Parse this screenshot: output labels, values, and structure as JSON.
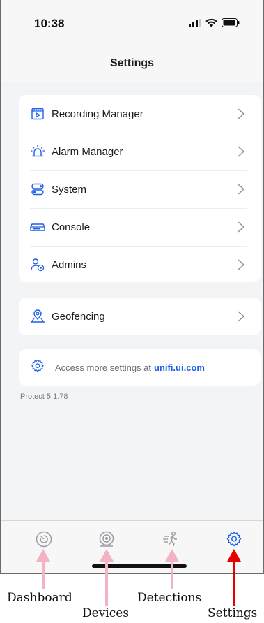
{
  "status_bar": {
    "time": "10:38"
  },
  "header": {
    "title": "Settings"
  },
  "menu": {
    "items": [
      {
        "label": "Recording Manager",
        "icon": "recording-manager-icon"
      },
      {
        "label": "Alarm Manager",
        "icon": "alarm-icon"
      },
      {
        "label": "System",
        "icon": "system-toggle-icon"
      },
      {
        "label": "Console",
        "icon": "console-icon"
      },
      {
        "label": "Admins",
        "icon": "admins-icon"
      }
    ]
  },
  "geofencing": {
    "label": "Geofencing",
    "icon": "location-icon"
  },
  "more_settings": {
    "text": "Access more settings at",
    "link": "unifi.ui.com"
  },
  "version": "Protect 5.1.78",
  "tabs": [
    {
      "name": "Dashboard",
      "icon": "dashboard-icon",
      "active": false
    },
    {
      "name": "Devices",
      "icon": "camera-icon",
      "active": false
    },
    {
      "name": "Detections",
      "icon": "running-person-icon",
      "active": false
    },
    {
      "name": "Settings",
      "icon": "gear-icon",
      "active": true
    }
  ],
  "annotations": {
    "dashboard": "Dashboard",
    "devices": "Devices",
    "detections": "Detections",
    "settings": "Settings"
  },
  "colors": {
    "accent": "#1f5fe6",
    "inactive_icon": "#9a9ca1",
    "annotation_pink": "#f4b3c2",
    "annotation_red": "#e60000"
  }
}
